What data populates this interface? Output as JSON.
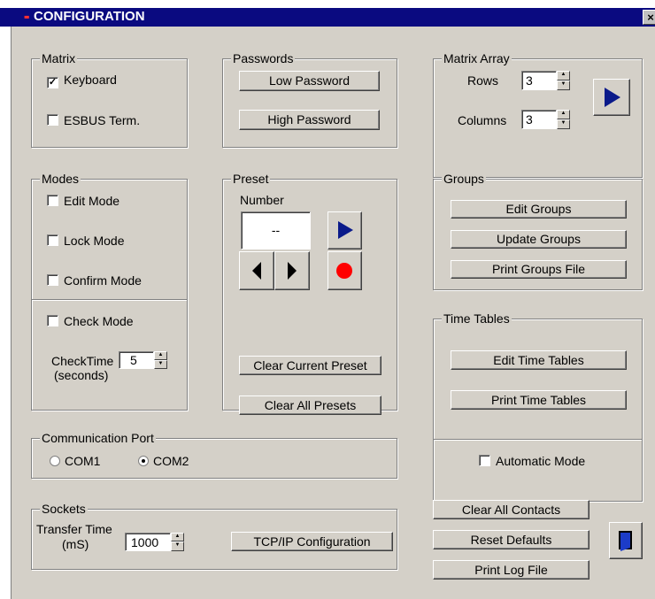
{
  "window": {
    "title": "CONFIGURATION",
    "close_glyph": "×"
  },
  "matrix": {
    "label": "Matrix",
    "keyboard": "Keyboard",
    "keyboard_checked": true,
    "esbus": "ESBUS Term.",
    "esbus_checked": false
  },
  "passwords": {
    "label": "Passwords",
    "low": "Low Password",
    "high": "High Password"
  },
  "matrix_array": {
    "label": "Matrix Array",
    "rows_label": "Rows",
    "rows_value": "3",
    "columns_label": "Columns",
    "columns_value": "3"
  },
  "modes": {
    "label": "Modes",
    "edit": "Edit Mode",
    "lock": "Lock Mode",
    "confirm": "Confirm Mode",
    "check": "Check Mode",
    "checktime_label": "CheckTime",
    "checktime_unit": "(seconds)",
    "checktime_value": "5"
  },
  "preset": {
    "label": "Preset",
    "number_label": "Number",
    "number_value": "--",
    "clear_current": "Clear Current Preset",
    "clear_all": "Clear All Presets"
  },
  "groups": {
    "label": "Groups",
    "edit": "Edit Groups",
    "update": "Update Groups",
    "print": "Print Groups File"
  },
  "time_tables": {
    "label": "Time Tables",
    "edit": "Edit Time Tables",
    "print": "Print Time Tables",
    "automatic": "Automatic Mode"
  },
  "comm_port": {
    "label": "Communication Port",
    "com1": "COM1",
    "com2": "COM2",
    "selected": "COM2"
  },
  "sockets": {
    "label": "Sockets",
    "transfer_label": "Transfer Time",
    "transfer_unit": "(mS)",
    "transfer_value": "1000",
    "tcpip": "TCP/IP Configuration"
  },
  "actions": {
    "clear_contacts": "Clear All Contacts",
    "reset_defaults": "Reset Defaults",
    "print_log": "Print Log File"
  },
  "colors": {
    "title_bar": "#0a0a80",
    "dialog_bg": "#d4d0c8",
    "arrow_blue": "#0a1a8a",
    "record_red": "#ff0000"
  }
}
